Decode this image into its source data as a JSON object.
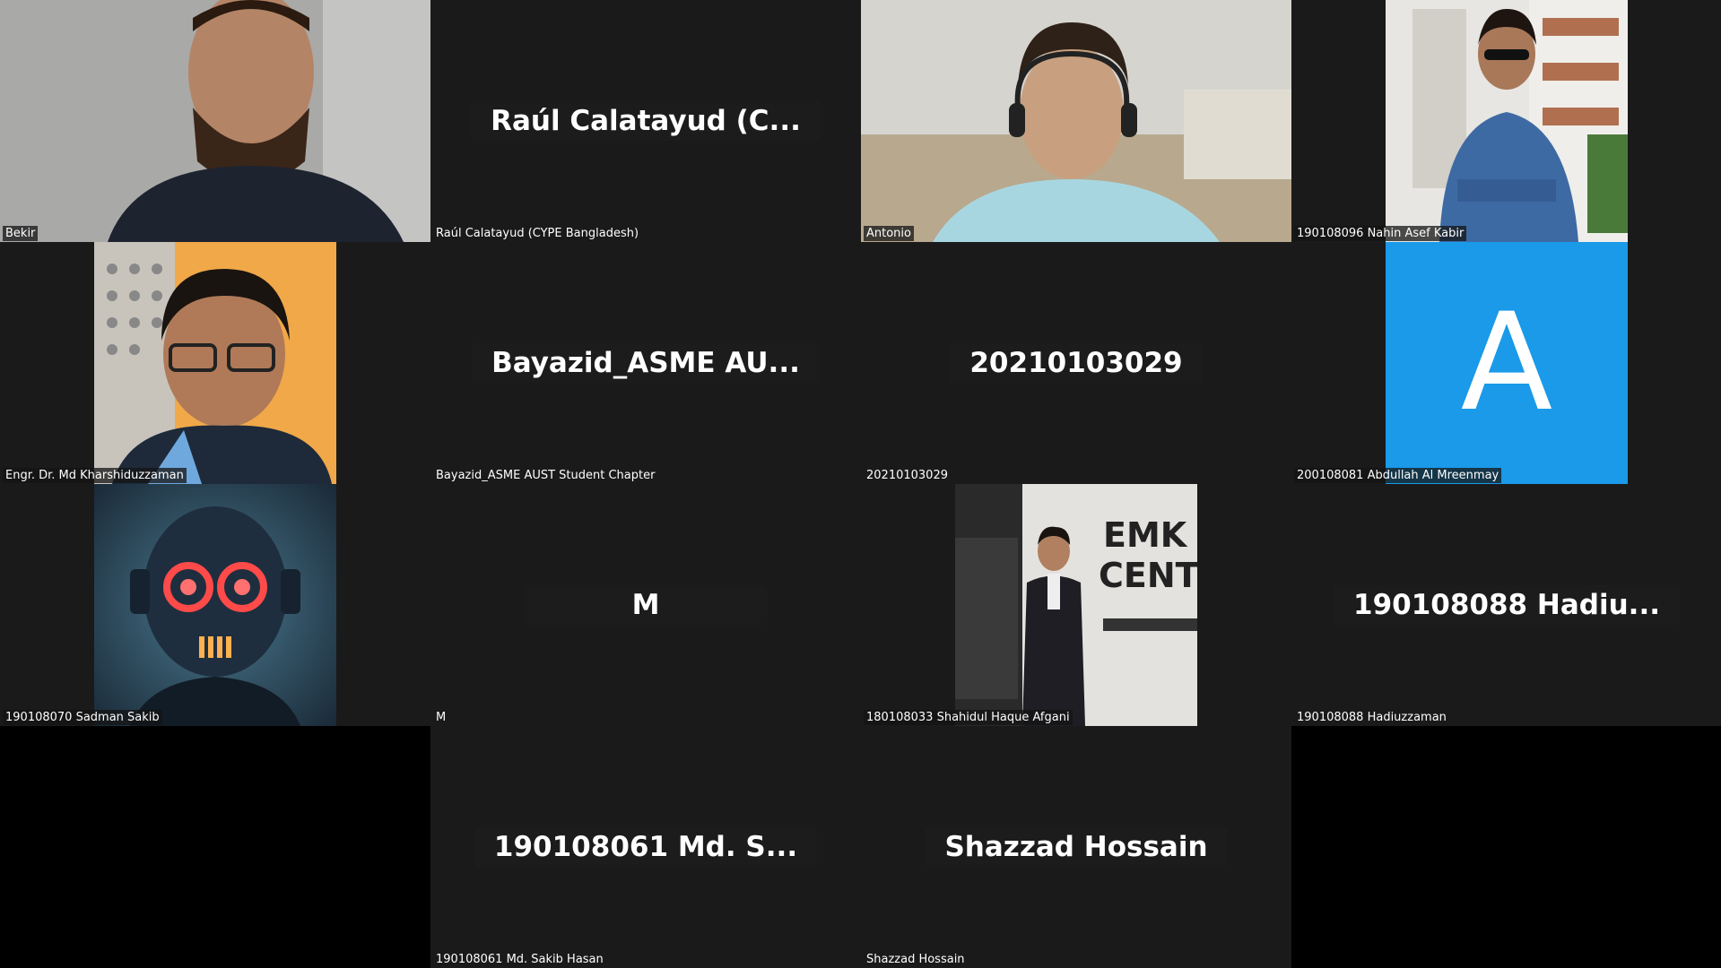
{
  "app": {
    "brand_avatar_color": "#1a9ae8"
  },
  "participants": [
    {
      "label": "Bekir",
      "type": "video"
    },
    {
      "label": "Raúl Calatayud (CYPE Bangladesh)",
      "display": "Raúl  Calatayud  (C...",
      "type": "name"
    },
    {
      "label": "Antonio",
      "type": "video"
    },
    {
      "label": "190108096  Nahin Asef Kabir",
      "type": "video"
    },
    {
      "label": "Engr. Dr. Md Kharshiduzzaman",
      "type": "video"
    },
    {
      "label": "Bayazid_ASME AUST Student Chapter",
      "display": "Bayazid_ASME  AU...",
      "type": "name"
    },
    {
      "label": "20210103029",
      "display": "20210103029",
      "type": "name"
    },
    {
      "label": "200108081 Abdullah Al Mreenmay",
      "avatar_letter": "A",
      "type": "avatar"
    },
    {
      "label": "190108070 Sadman Sakib",
      "type": "video"
    },
    {
      "label": "M",
      "display": "M",
      "type": "name"
    },
    {
      "label": "180108033 Shahidul Haque Afgani",
      "type": "video"
    },
    {
      "label": "190108088 Hadiuzzaman",
      "display": "190108088  Hadiu...",
      "type": "name"
    },
    {
      "label": "190108061 Md. Sakib Hasan",
      "display": "190108061  Md.  S...",
      "type": "name"
    },
    {
      "label": "Shazzad Hossain",
      "display": "Shazzad Hossain",
      "type": "name"
    }
  ]
}
